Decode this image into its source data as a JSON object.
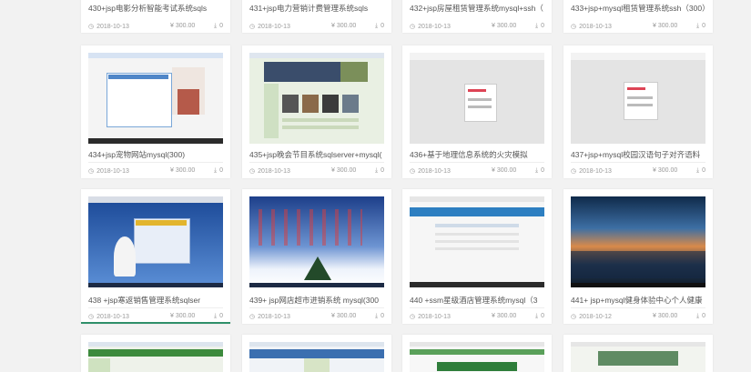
{
  "cards": [
    {
      "title": "430+jsp电影分析智能考试系统sqls",
      "date": "2018-10-13",
      "price": "¥ 300.00",
      "downloads": "0"
    },
    {
      "title": "431+jsp电力营销计费管理系统sqls",
      "date": "2018-10-13",
      "price": "¥ 300.00",
      "downloads": "0"
    },
    {
      "title": "432+jsp房屋租赁管理系统mysql+ssh（",
      "date": "2018-10-13",
      "price": "¥ 300.00",
      "downloads": "0"
    },
    {
      "title": "433+jsp+mysql租赁管理系统ssh（300）",
      "date": "2018-10-13",
      "price": "¥ 300.00",
      "downloads": "0"
    },
    {
      "title": "434+jsp宠物网站mysql(300)",
      "date": "2018-10-13",
      "price": "¥ 300.00",
      "downloads": "0"
    },
    {
      "title": "435+jsp晚会节目系统sqlserver+mysql(",
      "date": "2018-10-13",
      "price": "¥ 300.00",
      "downloads": "0"
    },
    {
      "title": "436+基于地理信息系统的火灾模拟",
      "date": "2018-10-13",
      "price": "¥ 300.00",
      "downloads": "0"
    },
    {
      "title": "437+jsp+mysql校园汉语句子对齐语料",
      "date": "2018-10-13",
      "price": "¥ 300.00",
      "downloads": "0"
    },
    {
      "title": "438 +jsp寒返销售管理系统sqlser",
      "date": "2018-10-13",
      "price": "¥ 300.00",
      "downloads": "0"
    },
    {
      "title": "439+ jsp网店超市进销系统 mysql(300",
      "date": "2018-10-13",
      "price": "¥ 300.00",
      "downloads": "0"
    },
    {
      "title": "440 +ssm星级酒店管理系统mysql（3",
      "date": "2018-10-13",
      "price": "¥ 300.00",
      "downloads": "0"
    },
    {
      "title": "441+ jsp+mysql健身体验中心个人健康",
      "date": "2018-10-12",
      "price": "¥ 300.00",
      "downloads": "0"
    }
  ]
}
